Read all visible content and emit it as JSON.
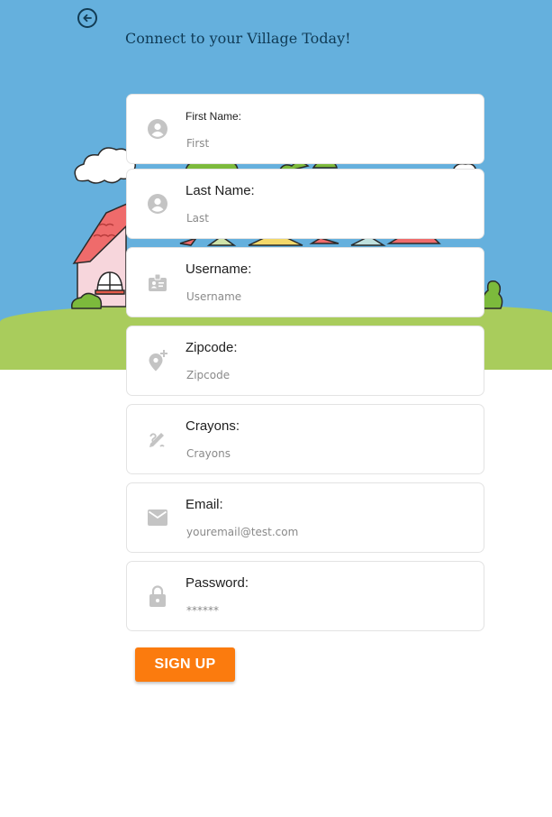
{
  "header": {
    "title": "Connect to your Village Today!",
    "back_icon": "arrow-left-circle-icon"
  },
  "form": {
    "fields": [
      {
        "key": "first_name",
        "label": "First Name:",
        "placeholder": "First",
        "icon": "account-circle-icon"
      },
      {
        "key": "last_name",
        "label": "Last Name:",
        "placeholder": "Last",
        "icon": "account-circle-icon"
      },
      {
        "key": "username",
        "label": "Username:",
        "placeholder": "Username",
        "icon": "badge-icon"
      },
      {
        "key": "zipcode",
        "label": "Zipcode:",
        "placeholder": "Zipcode",
        "icon": "add-location-icon"
      },
      {
        "key": "crayons",
        "label": "Crayons:",
        "placeholder": "Crayons",
        "icon": "draw-icon"
      },
      {
        "key": "email",
        "label": "Email:",
        "placeholder": "youremail@test.com",
        "icon": "mail-icon"
      },
      {
        "key": "password",
        "label": "Password:",
        "placeholder": "******",
        "icon": "lock-icon"
      }
    ],
    "submit_label": "SIGN UP"
  },
  "colors": {
    "sky": "#65b0dd",
    "grass": "#a9cc5c",
    "title": "#0f3a55",
    "button": "#fb7b0e",
    "icon": "#c4c4c4"
  }
}
